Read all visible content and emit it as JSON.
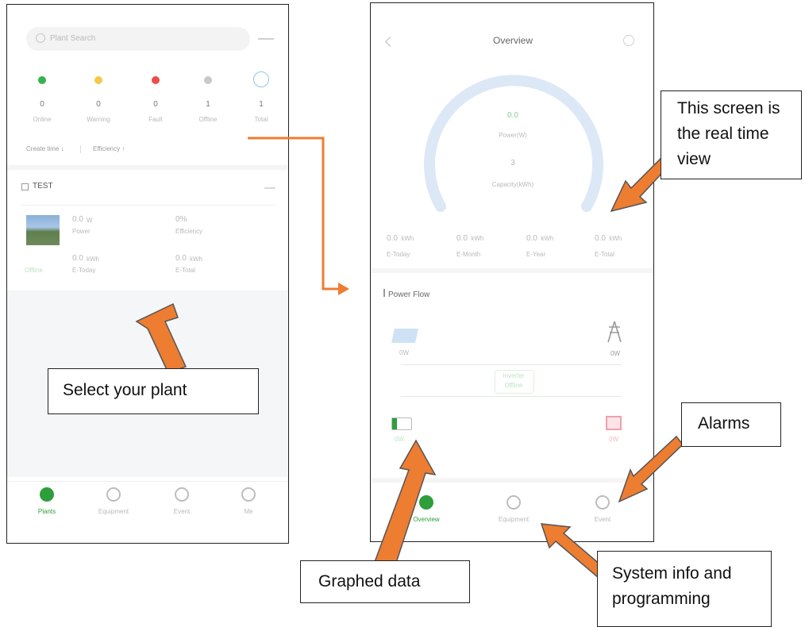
{
  "left_phone": {
    "search": {
      "placeholder": "Plant Search"
    },
    "status": [
      {
        "count": "0",
        "label": "Online",
        "color": "#37b24d"
      },
      {
        "count": "0",
        "label": "Warning",
        "color": "#f2c94c"
      },
      {
        "count": "0",
        "label": "Fault",
        "color": "#eb4d4b"
      },
      {
        "count": "1",
        "label": "Offline",
        "color": "#c9c9c9"
      },
      {
        "count": "1",
        "label": "Total",
        "color": "#8fc9e6"
      }
    ],
    "filters": [
      "Create time ↓",
      "Efficiency ↑"
    ],
    "plant": {
      "name": "TEST",
      "power": "0.0",
      "power_unit": "W",
      "power_label": "Power",
      "efficiency": "0%",
      "efficiency_label": "Efficiency",
      "today": "0.0",
      "today_unit": "kWh",
      "today_label": "E-Today",
      "total": "0.0",
      "total_unit": "kWh",
      "total_label": "E-Total",
      "tag": "Offline"
    },
    "nav": [
      "Plants",
      "Equipment",
      "Event",
      "Me"
    ]
  },
  "right_phone": {
    "title": "Overview",
    "gauge": {
      "power_value": "0.0",
      "power_label": "Power(W)",
      "capacity_value": "3",
      "capacity_label": "Capacity(kWh)"
    },
    "energy": [
      {
        "value": "0.0",
        "unit": "kWh",
        "label": "E-Today"
      },
      {
        "value": "0.0",
        "unit": "kWh",
        "label": "E-Month"
      },
      {
        "value": "0.0",
        "unit": "kWh",
        "label": "E-Year"
      },
      {
        "value": "0.0",
        "unit": "kWh",
        "label": "E-Total"
      }
    ],
    "power_flow": {
      "title": "Power Flow",
      "pv_label": "0W",
      "grid_label": "0W",
      "battery_label": "0W",
      "load_label": "0W",
      "center_label_1": "Inverter",
      "center_label_2": "Offline"
    },
    "nav": [
      "Overview",
      "Equipment",
      "Event"
    ]
  },
  "callouts": {
    "realtime": "This screen is the real time view",
    "select_plant": "Select your plant",
    "alarms": "Alarms",
    "graphed": "Graphed data",
    "system_info": "System info and programming"
  },
  "colors": {
    "arrow": "#ed7d31",
    "accent_green": "#2e9e3c",
    "gauge": "#dde8f6"
  }
}
